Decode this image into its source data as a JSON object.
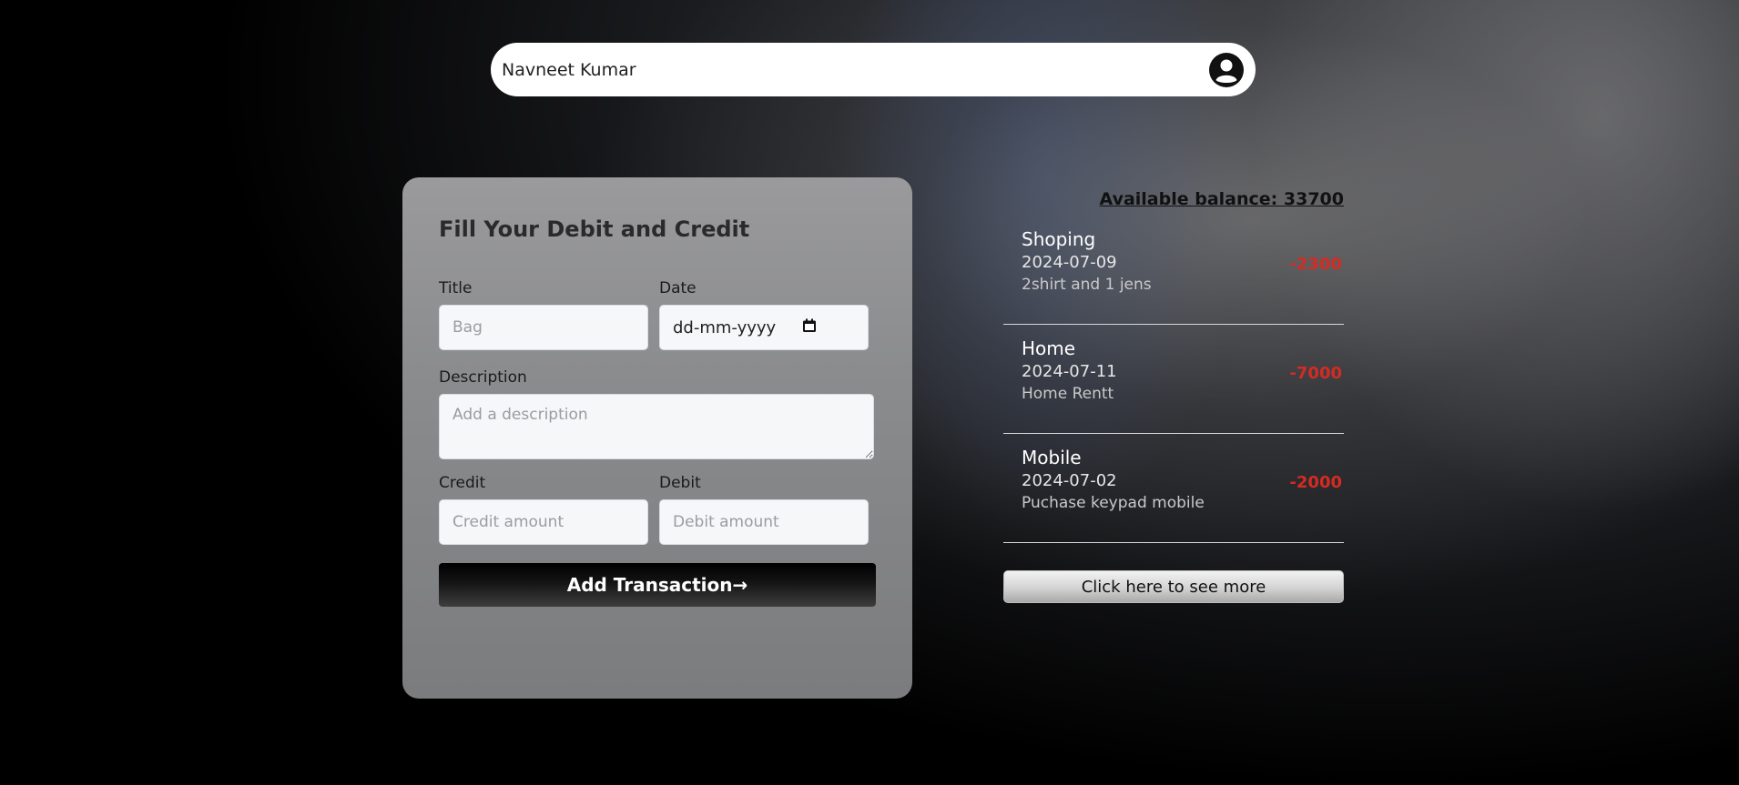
{
  "header": {
    "user_name": "Navneet Kumar",
    "avatar_icon": "user-circle-icon"
  },
  "form": {
    "title": "Fill Your Debit and Credit",
    "title_label": "Title",
    "title_placeholder": "Bag",
    "date_label": "Date",
    "date_placeholder": "dd-mm-yyyy",
    "date_icon": "calendar-icon",
    "description_label": "Description",
    "description_placeholder": "Add a description",
    "credit_label": "Credit",
    "credit_placeholder": "Credit amount",
    "debit_label": "Debit",
    "debit_placeholder": "Debit amount",
    "submit_label": "Add Transaction→"
  },
  "summary": {
    "balance_text": "Available balance: 33700"
  },
  "transactions": [
    {
      "title": "Shoping",
      "date": "2024-07-09",
      "description": "2shirt and 1 jens",
      "amount": "-2300"
    },
    {
      "title": "Home",
      "date": "2024-07-11",
      "description": "Home Rentt",
      "amount": "-7000"
    },
    {
      "title": "Mobile",
      "date": "2024-07-02",
      "description": "Puchase keypad mobile",
      "amount": "-2000"
    }
  ],
  "more_button_label": "Click here to see more",
  "colors": {
    "debit_amount": "#d42b23",
    "button_dark": "#000000",
    "card_bg": "#8a8b8d"
  }
}
